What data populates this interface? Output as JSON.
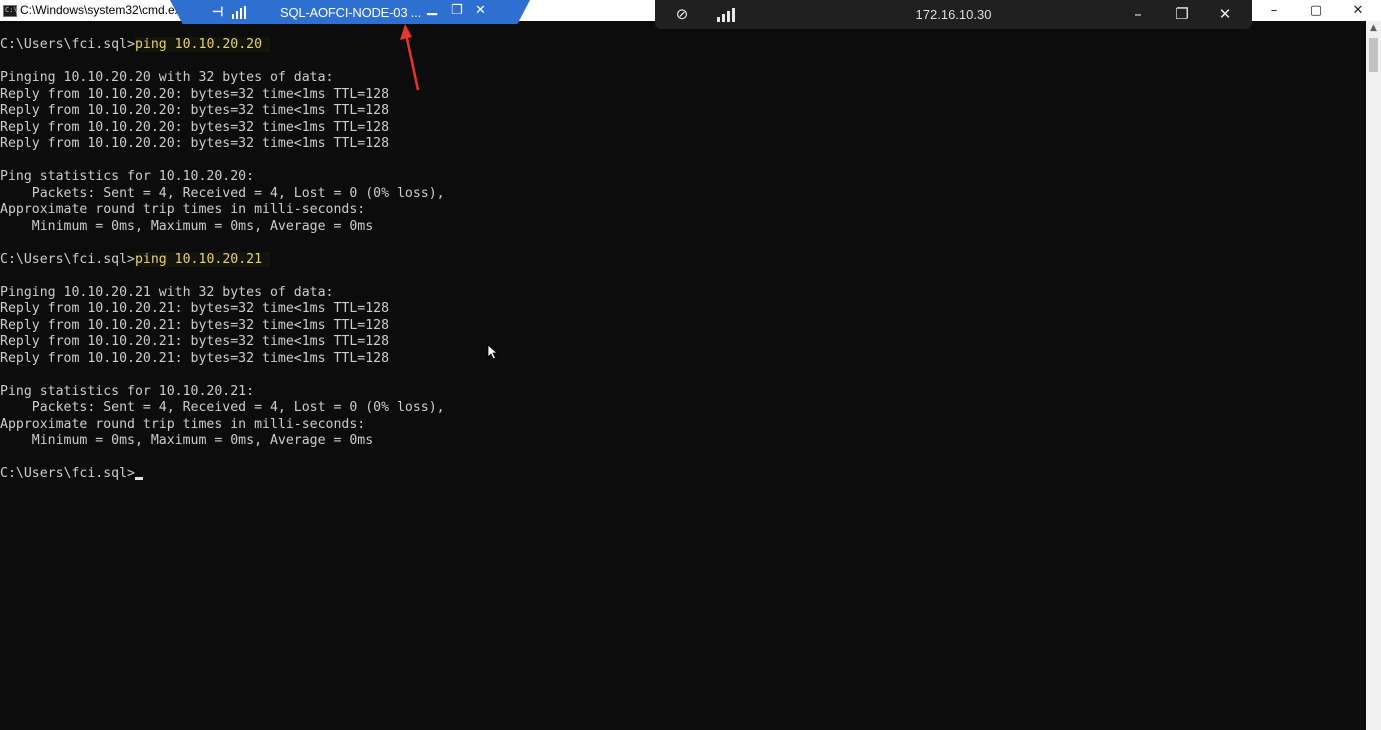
{
  "window": {
    "title": "C:\\Windows\\system32\\cmd.exe",
    "icon": "cmd-icon",
    "minimize": "–",
    "maximize": "▢",
    "close": "✕"
  },
  "rdp_bar": {
    "title": "SQL-AOFCI-NODE-03 ...",
    "pin_icon": "pin-icon",
    "signal_icon": "signal-icon",
    "color": "#2f6fd0"
  },
  "connection_bar": {
    "title": "172.16.10.30",
    "unpin_icon": "unpin-icon",
    "signal_icon": "signal-icon"
  },
  "console": {
    "prompt": "C:\\Users\\fci.sql>",
    "lines": [
      {
        "prompt": "C:\\Users\\fci.sql>",
        "cmd": "ping 10.10.20.20 "
      },
      {
        "text": ""
      },
      {
        "text": "Pinging 10.10.20.20 with 32 bytes of data:"
      },
      {
        "text": "Reply from 10.10.20.20: bytes=32 time<1ms TTL=128"
      },
      {
        "text": "Reply from 10.10.20.20: bytes=32 time<1ms TTL=128"
      },
      {
        "text": "Reply from 10.10.20.20: bytes=32 time<1ms TTL=128"
      },
      {
        "text": "Reply from 10.10.20.20: bytes=32 time<1ms TTL=128"
      },
      {
        "text": ""
      },
      {
        "text": "Ping statistics for 10.10.20.20:"
      },
      {
        "text": "    Packets: Sent = 4, Received = 4, Lost = 0 (0% loss),"
      },
      {
        "text": "Approximate round trip times in milli-seconds:"
      },
      {
        "text": "    Minimum = 0ms, Maximum = 0ms, Average = 0ms"
      },
      {
        "text": ""
      },
      {
        "prompt": "C:\\Users\\fci.sql>",
        "cmd": "ping 10.10.20.21 "
      },
      {
        "text": ""
      },
      {
        "text": "Pinging 10.10.20.21 with 32 bytes of data:"
      },
      {
        "text": "Reply from 10.10.20.21: bytes=32 time<1ms TTL=128"
      },
      {
        "text": "Reply from 10.10.20.21: bytes=32 time<1ms TTL=128"
      },
      {
        "text": "Reply from 10.10.20.21: bytes=32 time<1ms TTL=128"
      },
      {
        "text": "Reply from 10.10.20.21: bytes=32 time<1ms TTL=128"
      },
      {
        "text": ""
      },
      {
        "text": "Ping statistics for 10.10.20.21:"
      },
      {
        "text": "    Packets: Sent = 4, Received = 4, Lost = 0 (0% loss),"
      },
      {
        "text": "Approximate round trip times in milli-seconds:"
      },
      {
        "text": "    Minimum = 0ms, Maximum = 0ms, Average = 0ms"
      },
      {
        "text": ""
      },
      {
        "prompt": "C:\\Users\\fci.sql>",
        "cmd": "",
        "cursor": true
      }
    ],
    "text_color": "#cccccc",
    "command_color": "#e6d36b",
    "background": "#0c0c0c"
  },
  "annotation": {
    "color": "#e8342a"
  }
}
